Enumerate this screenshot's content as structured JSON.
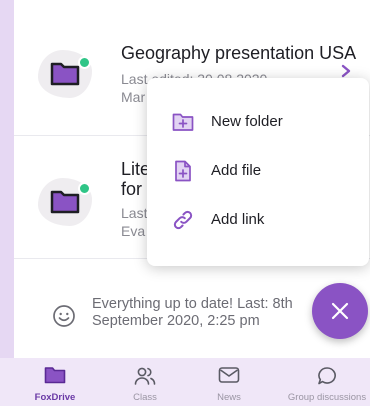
{
  "files": [
    {
      "title": "Geography presentation USA",
      "meta_line1": "Last edited: 30.08.2020",
      "meta_line2": "Mar",
      "status_color": "#2fc587"
    },
    {
      "title_line1": "Lite",
      "title_line2": "for",
      "meta_line1": "Last",
      "meta_line2": "Eva",
      "status_color": "#2fc587"
    }
  ],
  "menu": {
    "items": [
      {
        "label": "New folder",
        "icon": "folder-plus-icon"
      },
      {
        "label": "Add file",
        "icon": "file-plus-icon"
      },
      {
        "label": "Add link",
        "icon": "link-icon"
      }
    ]
  },
  "status": {
    "text": "Everything up to date! Last: 8th September 2020, 2:25 pm",
    "icon": "smiley-icon"
  },
  "fab": {
    "icon": "close-icon"
  },
  "nav": {
    "items": [
      {
        "label": "FoxDrive",
        "icon": "folder-icon",
        "active": true
      },
      {
        "label": "Class",
        "icon": "people-icon",
        "active": false
      },
      {
        "label": "News",
        "icon": "mail-icon",
        "active": false
      },
      {
        "label": "Group discussions",
        "icon": "chat-bubble-icon",
        "active": false
      }
    ]
  },
  "colors": {
    "accent": "#8a53c4",
    "background": "#e6d8f3",
    "online": "#2fc587"
  }
}
